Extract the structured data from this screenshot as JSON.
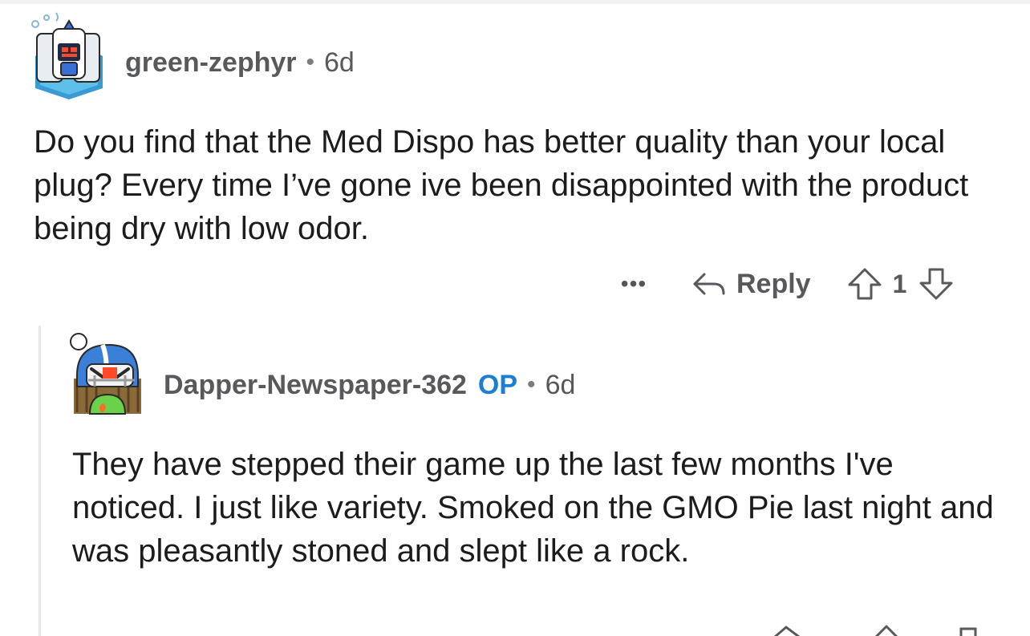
{
  "comments": [
    {
      "username": "green-zephyr",
      "separator": "•",
      "age": "6d",
      "body": "Do you find that the Med Dispo has better quality than your local plug? Every time I’ve gone ive been disappointed with the product being dry with low odor.",
      "actions": {
        "more_label": "•••",
        "reply_label": "Reply",
        "vote_count": "1"
      }
    },
    {
      "username": "Dapper-Newspaper-362",
      "badge": "OP",
      "separator": "•",
      "age": "6d",
      "body": "They have stepped their game up the last few months I've noticed. I just like variety. Smoked on the GMO Pie last night and was pleasantly stoned and slept like a rock."
    }
  ],
  "icons": {
    "reply": "reply-arrow-icon",
    "upvote": "upvote-arrow-icon",
    "downvote": "downvote-arrow-icon"
  },
  "colors": {
    "op_badge": "#1a7fd4",
    "username": "#57595c",
    "body_text": "#1c1c1c",
    "thread_line": "#e6e6e6"
  }
}
